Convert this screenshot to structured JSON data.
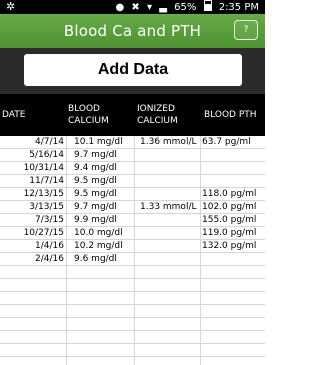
{
  "status_bar": {
    "time": "2:35 PM",
    "battery": "65%",
    "icons": [
      "bluetooth-icon",
      "location-icon",
      "mute-icon",
      "wifi-icon",
      "signal-icon",
      "battery-icon"
    ]
  },
  "header": {
    "title": "Blood Ca and PTH",
    "help_label": "?"
  },
  "toolbar": {
    "add_label": "Add Data"
  },
  "table": {
    "columns": [
      "DATE",
      "BLOOD CALCIUM",
      "IONIZED CALCIUM",
      "BLOOD PTH"
    ],
    "rows": [
      {
        "date": "4/7/14",
        "calcium": "10.1 mg/dl",
        "ionized": "1.36 mmol/L",
        "pth": "63.7 pg/ml"
      },
      {
        "date": "5/16/14",
        "calcium": "9.7 mg/dl",
        "ionized": "",
        "pth": ""
      },
      {
        "date": "10/31/14",
        "calcium": "9.4 mg/dl",
        "ionized": "",
        "pth": ""
      },
      {
        "date": "11/7/14",
        "calcium": "9.5 mg/dl",
        "ionized": "",
        "pth": ""
      },
      {
        "date": "12/13/15",
        "calcium": "9.5 mg/dl",
        "ionized": "",
        "pth": "118.0 pg/ml"
      },
      {
        "date": "3/13/15",
        "calcium": "9.7 mg/dl",
        "ionized": "1.33 mmol/L",
        "pth": "102.0 pg/ml"
      },
      {
        "date": "7/3/15",
        "calcium": "9.9 mg/dl",
        "ionized": "",
        "pth": "155.0 pg/ml"
      },
      {
        "date": "10/27/15",
        "calcium": "10.0 mg/dl",
        "ionized": "",
        "pth": "119.0 pg/ml"
      },
      {
        "date": "1/4/16",
        "calcium": "10.2 mg/dl",
        "ionized": "",
        "pth": "132.0 pg/ml"
      },
      {
        "date": "2/4/16",
        "calcium": "9.6 mg/dl",
        "ionized": "",
        "pth": ""
      }
    ],
    "empty_rows": 7
  },
  "colors": {
    "title_bar": "#5a9e3c",
    "toolbar_bg": "#2b2b2b",
    "header_bg": "#000000"
  }
}
